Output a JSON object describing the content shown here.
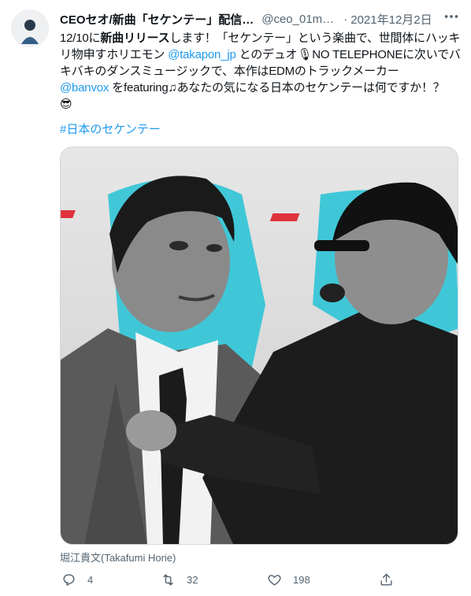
{
  "tweet": {
    "author_name": "CEOセオ/新曲「セケンテー」配信…",
    "handle": "@ceo_01mu…",
    "separator": "·",
    "date": "2021年12月2日",
    "text_1": "12/10に",
    "text_bold": "新曲リリース",
    "text_2": "します！「セケンテー」という楽曲で、世間体にハッキリ物申すホリエモン ",
    "mention_1": "@takapon_jp",
    "text_3": " とのデュオ",
    "mic_emoji": "🎙",
    "text_4": "NO TELEPHONEに次いでバキバキのダンスミュージックで、本作はEDMのトラックメーカー",
    "mention_2": "@banvox",
    "text_5": " をfeaturing♫あなたの気になる日本のセケンテーは何ですか！？",
    "sunglasses_emoji": "😎",
    "hashtag": "#日本のセケンテー",
    "media_caption": "堀江貴文(Takafumi Horie)"
  },
  "actions": {
    "reply_count": "4",
    "retweet_count": "32",
    "like_count": "198"
  },
  "icons": {
    "more": "more-icon",
    "reply": "reply-icon",
    "retweet": "retweet-icon",
    "like": "heart-icon",
    "share": "share-icon"
  },
  "colors": {
    "link": "#1d9bf0",
    "secondary_text": "#536471",
    "media_accent": "#2ec4d6"
  }
}
